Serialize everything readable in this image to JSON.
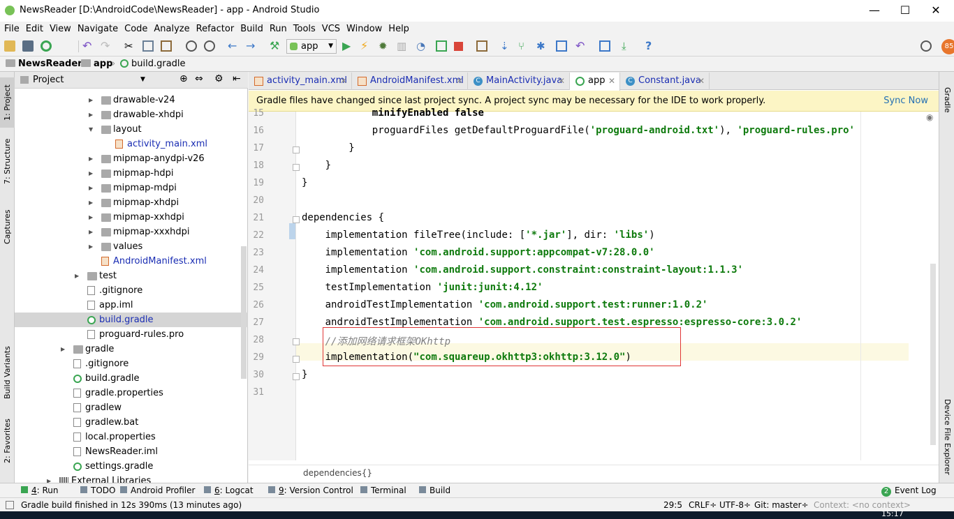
{
  "window": {
    "title": "NewsReader [D:\\AndroidCode\\NewsReader] - app - Android Studio",
    "minimize": "—",
    "maximize": "☐",
    "close": "✕"
  },
  "menu": [
    "File",
    "Edit",
    "View",
    "Navigate",
    "Code",
    "Analyze",
    "Refactor",
    "Build",
    "Run",
    "Tools",
    "VCS",
    "Window",
    "Help"
  ],
  "toolbar": {
    "run_config": "app",
    "badge": "85"
  },
  "breadcrumb": [
    "NewsReader",
    "app",
    "build.gradle"
  ],
  "left_tabs": [
    "1: Project",
    "7: Structure",
    "Captures",
    "Build Variants",
    "2: Favorites"
  ],
  "right_tabs": [
    "Gradle",
    "Device File Explorer"
  ],
  "project_panel": {
    "title": "Project",
    "tree": [
      {
        "label": "drawable-v24",
        "type": "folder",
        "arrow": "›"
      },
      {
        "label": "drawable-xhdpi",
        "type": "folder",
        "arrow": "›"
      },
      {
        "label": "layout",
        "type": "folder",
        "arrow": "⌄"
      },
      {
        "label": "activity_main.xml",
        "type": "xml",
        "arrow": ""
      },
      {
        "label": "mipmap-anydpi-v26",
        "type": "folder",
        "arrow": "›"
      },
      {
        "label": "mipmap-hdpi",
        "type": "folder",
        "arrow": "›"
      },
      {
        "label": "mipmap-mdpi",
        "type": "folder",
        "arrow": "›"
      },
      {
        "label": "mipmap-xhdpi",
        "type": "folder",
        "arrow": "›"
      },
      {
        "label": "mipmap-xxhdpi",
        "type": "folder",
        "arrow": "›"
      },
      {
        "label": "mipmap-xxxhdpi",
        "type": "folder",
        "arrow": "›"
      },
      {
        "label": "values",
        "type": "folder",
        "arrow": "›"
      },
      {
        "label": "AndroidManifest.xml",
        "type": "xml",
        "arrow": ""
      },
      {
        "label": "test",
        "type": "folder",
        "arrow": "›"
      },
      {
        "label": ".gitignore",
        "type": "file",
        "arrow": ""
      },
      {
        "label": "app.iml",
        "type": "file",
        "arrow": ""
      },
      {
        "label": "build.gradle",
        "type": "gradle",
        "arrow": ""
      },
      {
        "label": "proguard-rules.pro",
        "type": "file",
        "arrow": ""
      },
      {
        "label": "gradle",
        "type": "folder",
        "arrow": "›"
      },
      {
        "label": ".gitignore",
        "type": "file",
        "arrow": ""
      },
      {
        "label": "build.gradle",
        "type": "gradle",
        "arrow": ""
      },
      {
        "label": "gradle.properties",
        "type": "file",
        "arrow": ""
      },
      {
        "label": "gradlew",
        "type": "file",
        "arrow": ""
      },
      {
        "label": "gradlew.bat",
        "type": "file",
        "arrow": ""
      },
      {
        "label": "local.properties",
        "type": "file",
        "arrow": ""
      },
      {
        "label": "NewsReader.iml",
        "type": "file",
        "arrow": ""
      },
      {
        "label": "settings.gradle",
        "type": "gradle",
        "arrow": ""
      },
      {
        "label": "External Libraries",
        "type": "lib",
        "arrow": "›"
      }
    ]
  },
  "tabs": [
    {
      "label": "activity_main.xml",
      "icon": "xml",
      "active": false
    },
    {
      "label": "AndroidManifest.xml",
      "icon": "xml",
      "active": false
    },
    {
      "label": "MainActivity.java",
      "icon": "c",
      "active": false
    },
    {
      "label": "app",
      "icon": "g",
      "active": true
    },
    {
      "label": "Constant.java",
      "icon": "c",
      "active": false
    }
  ],
  "banner": {
    "message": "Gradle files have changed since last project sync. A project sync may be necessary for the IDE to work properly.",
    "action": "Sync Now"
  },
  "code_lines": [
    {
      "n": "15",
      "indent": 12,
      "parts": [
        {
          "t": "minifyEnabled false",
          "c": "kw"
        }
      ]
    },
    {
      "n": "16",
      "indent": 12,
      "parts": [
        {
          "t": "proguardFiles getDefaultProguardFile(",
          "c": ""
        },
        {
          "t": "'proguard-android.txt'",
          "c": "str"
        },
        {
          "t": "), ",
          "c": ""
        },
        {
          "t": "'proguard-rules.pro'",
          "c": "str"
        }
      ]
    },
    {
      "n": "17",
      "indent": 8,
      "parts": [
        {
          "t": "}",
          "c": ""
        }
      ]
    },
    {
      "n": "18",
      "indent": 4,
      "parts": [
        {
          "t": "}",
          "c": ""
        }
      ]
    },
    {
      "n": "19",
      "indent": 0,
      "parts": [
        {
          "t": "}",
          "c": ""
        }
      ]
    },
    {
      "n": "20",
      "indent": 0,
      "parts": []
    },
    {
      "n": "21",
      "indent": 0,
      "parts": [
        {
          "t": "dependencies {",
          "c": ""
        }
      ]
    },
    {
      "n": "22",
      "indent": 4,
      "parts": [
        {
          "t": "implementation fileTree(include: [",
          "c": ""
        },
        {
          "t": "'*.jar'",
          "c": "str"
        },
        {
          "t": "], dir: ",
          "c": ""
        },
        {
          "t": "'libs'",
          "c": "str"
        },
        {
          "t": ")",
          "c": ""
        }
      ]
    },
    {
      "n": "23",
      "indent": 4,
      "parts": [
        {
          "t": "implementation ",
          "c": ""
        },
        {
          "t": "'com.android.support:appcompat-v7:28.0.0'",
          "c": "str"
        }
      ]
    },
    {
      "n": "24",
      "indent": 4,
      "parts": [
        {
          "t": "implementation ",
          "c": ""
        },
        {
          "t": "'com.android.support.constraint:constraint-layout:1.1.3'",
          "c": "str"
        }
      ]
    },
    {
      "n": "25",
      "indent": 4,
      "parts": [
        {
          "t": "testImplementation ",
          "c": ""
        },
        {
          "t": "'junit:junit:4.12'",
          "c": "str"
        }
      ]
    },
    {
      "n": "26",
      "indent": 4,
      "parts": [
        {
          "t": "androidTestImplementation ",
          "c": ""
        },
        {
          "t": "'com.android.support.test:runner:1.0.2'",
          "c": "str"
        }
      ]
    },
    {
      "n": "27",
      "indent": 4,
      "parts": [
        {
          "t": "androidTestImplementation ",
          "c": ""
        },
        {
          "t": "'com.android.support.test.espresso:espresso-core:3.0.2'",
          "c": "str"
        }
      ]
    },
    {
      "n": "28",
      "indent": 4,
      "parts": [
        {
          "t": "//添加网络请求框架OKhttp",
          "c": "cmt"
        }
      ]
    },
    {
      "n": "29",
      "indent": 4,
      "parts": [
        {
          "t": "implementation(",
          "c": ""
        },
        {
          "t": "\"com.squareup.okhttp3:okhttp:3.12.0\"",
          "c": "str"
        },
        {
          "t": ")",
          "c": ""
        }
      ]
    },
    {
      "n": "30",
      "indent": 0,
      "parts": [
        {
          "t": "}",
          "c": ""
        }
      ]
    },
    {
      "n": "31",
      "indent": 0,
      "parts": []
    }
  ],
  "editor_footer": "dependencies{}",
  "bottom_tools": [
    {
      "key": "4",
      "label": ": Run"
    },
    {
      "key": "",
      "label": "TODO"
    },
    {
      "key": "",
      "label": "Android Profiler"
    },
    {
      "key": "6",
      "label": ": Logcat"
    },
    {
      "key": "9",
      "label": ": Version Control"
    },
    {
      "key": "",
      "label": "Terminal"
    },
    {
      "key": "",
      "label": "Build"
    }
  ],
  "event_log": {
    "count": "2",
    "label": "Event Log"
  },
  "status": {
    "message": "Gradle build finished in 12s 390ms (13 minutes ago)",
    "position": "29:5",
    "line_sep": "CRLF÷",
    "encoding": "UTF-8÷",
    "git": "Git: master÷",
    "context": "Context: <no context>"
  },
  "taskbar": {
    "time": "15:17"
  }
}
